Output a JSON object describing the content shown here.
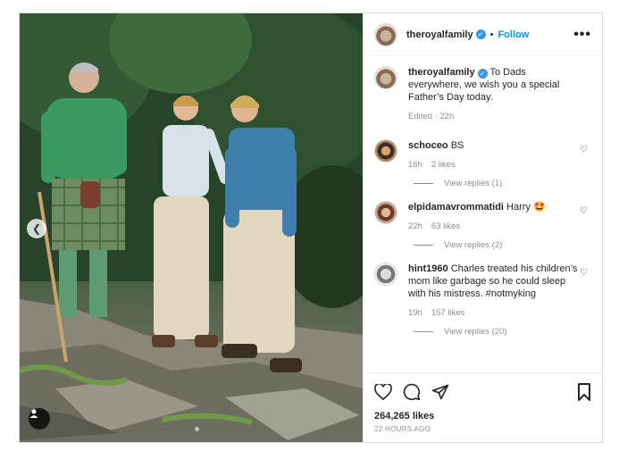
{
  "post": {
    "username": "theroyalfamily",
    "follow_label": "Follow",
    "separator": "•",
    "caption_user": "theroyalfamily",
    "caption": "To Dads everywhere, we wish you a special Father’s Day today.",
    "caption_meta": "Edited · 22h",
    "likes": "264,265 likes",
    "time_ago": "22 HOURS AGO"
  },
  "comments": [
    {
      "user": "schoceo",
      "text": "BS",
      "age": "16h",
      "likes": "2 likes",
      "replies": "View replies (1)"
    },
    {
      "user": "elpidamavrommatidi",
      "text": "Harry 🤩",
      "age": "22h",
      "likes": "63 likes",
      "replies": "View replies (2)"
    },
    {
      "user": "hint1960",
      "text": "Charles treated his children’s mom like garbage so he could sleep with his mistress. #notmyking",
      "age": "19h",
      "likes": "157 likes",
      "replies": "View replies (20)"
    }
  ],
  "icons": {
    "verified": "verified-badge-icon",
    "more": "more-options-icon",
    "heart": "heart-icon",
    "comment": "comment-icon",
    "share": "share-icon",
    "save": "bookmark-icon",
    "user_tag": "user-tag-icon",
    "prev": "chevron-left-icon"
  },
  "colors": {
    "accent": "#0095f6",
    "verified": "#3897f0",
    "muted": "#8e8e8e"
  }
}
